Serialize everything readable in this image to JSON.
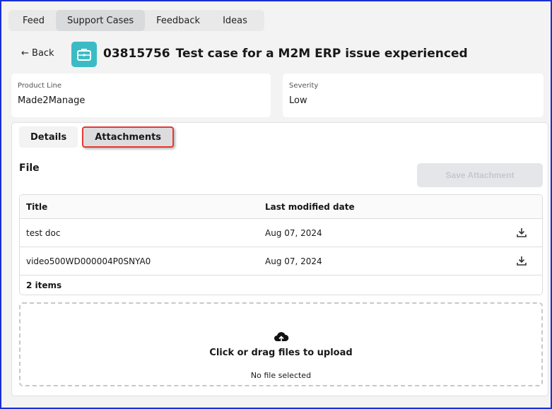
{
  "nav": {
    "tabs": [
      {
        "label": "Feed"
      },
      {
        "label": "Support Cases",
        "active": true
      },
      {
        "label": "Feedback"
      },
      {
        "label": "Ideas"
      }
    ]
  },
  "header": {
    "back_label": "← Back",
    "icon": "briefcase-icon",
    "case_number": "03815756",
    "case_title": "Test case for a M2M ERP issue experienced",
    "icon_color": "#3bbcc5"
  },
  "fields": {
    "product_line": {
      "label": "Product Line",
      "value": "Made2Manage"
    },
    "severity": {
      "label": "Severity",
      "value": "Low"
    }
  },
  "subtabs": [
    {
      "label": "Details"
    },
    {
      "label": "Attachments",
      "active": true
    }
  ],
  "file": {
    "heading": "File",
    "save_label": "Save Attachment",
    "columns": [
      "Title",
      "Last modified date"
    ],
    "rows": [
      {
        "title": "test doc",
        "date": "Aug 07, 2024"
      },
      {
        "title": "video500WD000004P0SNYA0",
        "date": "Aug 07, 2024"
      }
    ],
    "count": "2 items"
  },
  "upload": {
    "message": "Click or drag files to upload",
    "status": "No file selected"
  }
}
